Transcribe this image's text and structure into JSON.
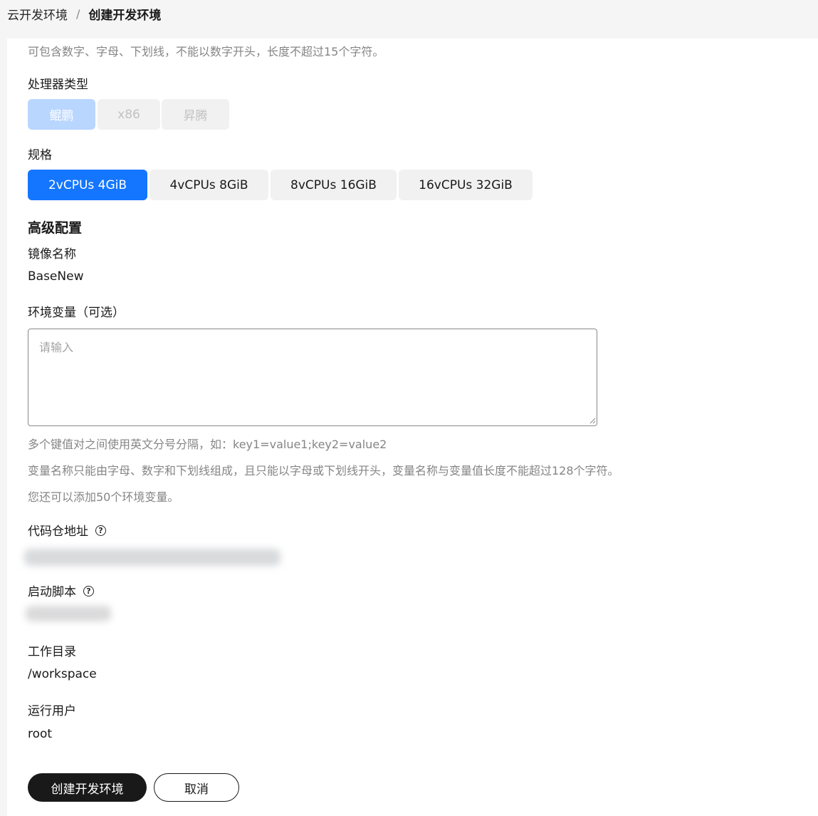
{
  "breadcrumb": {
    "parent": "云开发环境",
    "separator": "/",
    "current": "创建开发环境"
  },
  "name_hint": "可包含数字、字母、下划线，不能以数字开头，长度不超过15个字符。",
  "processor": {
    "label": "处理器类型",
    "options": [
      "鲲鹏",
      "x86",
      "昇腾"
    ],
    "selected": "鲲鹏",
    "state": "disabled"
  },
  "spec": {
    "label": "规格",
    "options": [
      "2vCPUs 4GiB",
      "4vCPUs 8GiB",
      "8vCPUs 16GiB",
      "16vCPUs 32GiB"
    ],
    "selected": "2vCPUs 4GiB"
  },
  "advanced": {
    "title": "高级配置",
    "image_name": {
      "label": "镜像名称",
      "value": "BaseNew"
    },
    "env_vars": {
      "label": "环境变量（可选）",
      "placeholder": "请输入",
      "value": "",
      "hints": [
        "多个键值对之间使用英文分号分隔，如：key1=value1;key2=value2",
        "变量名称只能由字母、数字和下划线组成，且只能以字母或下划线开头，变量名称与变量值长度不能超过128个字符。",
        "您还可以添加50个环境变量。"
      ]
    },
    "repo": {
      "label": "代码仓地址",
      "help_icon": "question-circle-icon",
      "value_redacted": true
    },
    "startup_script": {
      "label": "启动脚本",
      "help_icon": "question-circle-icon",
      "value_redacted": true
    },
    "workdir": {
      "label": "工作目录",
      "value": "/workspace"
    },
    "run_user": {
      "label": "运行用户",
      "value": "root"
    }
  },
  "actions": {
    "create_label": "创建开发环境",
    "cancel_label": "取消"
  },
  "colors": {
    "primary_blue": "#1476ff",
    "primary_disabled_blue": "#b9d6ff",
    "dark_button": "#191919",
    "hint_text": "#858585"
  }
}
